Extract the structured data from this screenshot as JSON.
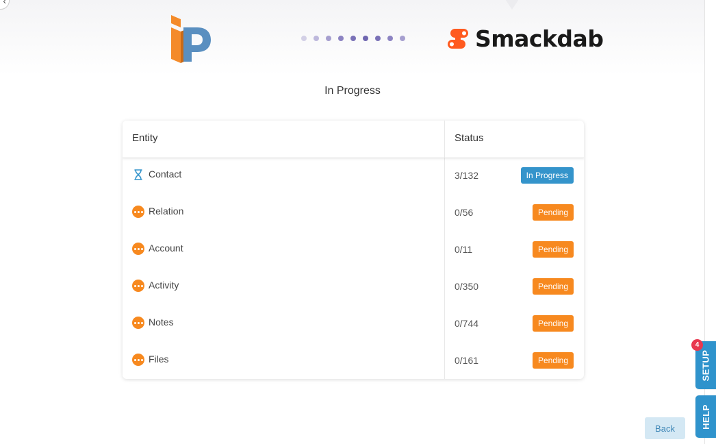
{
  "header": {
    "left_logo": "ip-logo",
    "right_logo_text": "Smackdab",
    "right_logo_icon": "smackdab-icon",
    "step_dots": [
      "#d3d0e6",
      "#bdb8dc",
      "#a69fcf",
      "#8c83c2",
      "#7a71b7",
      "#6f66b0",
      "#7a71b7",
      "#8c83c2",
      "#a69fcf"
    ]
  },
  "page_title": "In Progress",
  "table": {
    "headers": {
      "entity": "Entity",
      "status": "Status"
    },
    "rows": [
      {
        "name": "Contact",
        "count": "3/132",
        "status": "In Progress",
        "state": "progress",
        "icon": "hourglass-icon"
      },
      {
        "name": "Relation",
        "count": "0/56",
        "status": "Pending",
        "state": "pending",
        "icon": "more-dots-icon"
      },
      {
        "name": "Account",
        "count": "0/11",
        "status": "Pending",
        "state": "pending",
        "icon": "more-dots-icon"
      },
      {
        "name": "Activity",
        "count": "0/350",
        "status": "Pending",
        "state": "pending",
        "icon": "more-dots-icon"
      },
      {
        "name": "Notes",
        "count": "0/744",
        "status": "Pending",
        "state": "pending",
        "icon": "more-dots-icon"
      },
      {
        "name": "Files",
        "count": "0/161",
        "status": "Pending",
        "state": "pending",
        "icon": "more-dots-icon"
      }
    ]
  },
  "side_tabs": {
    "setup_label": "SETUP",
    "setup_count": "4",
    "help_label": "HELP"
  },
  "footer": {
    "back_label": "Back"
  },
  "colors": {
    "progress": "#3494cb",
    "pending": "#f7891f",
    "accent": "#2f93cc"
  }
}
